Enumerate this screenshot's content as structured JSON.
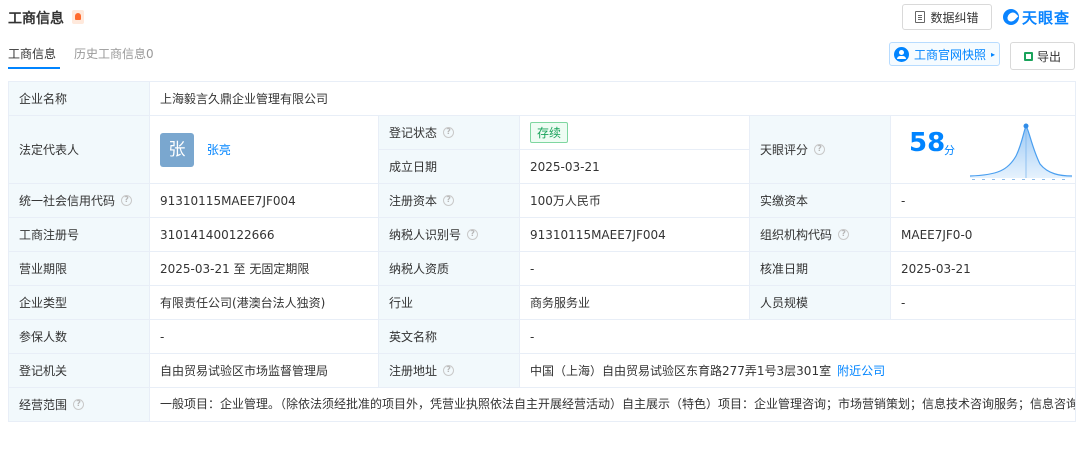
{
  "header": {
    "title": "工商信息",
    "correct_btn": "数据纠错",
    "brand": "天眼查"
  },
  "tabs": [
    {
      "label": "工商信息",
      "active": true
    },
    {
      "label": "历史工商信息0",
      "active": false
    }
  ],
  "actions": {
    "snapshot": "工商官网快照",
    "export": "导出"
  },
  "company": {
    "name_label": "企业名称",
    "name": "上海毅言久鼎企业管理有限公司",
    "legal_rep_label": "法定代表人",
    "legal_rep_avatar": "张",
    "legal_rep_name": "张亮",
    "reg_status_label": "登记状态",
    "reg_status": "存续",
    "est_date_label": "成立日期",
    "est_date": "2025-03-21",
    "score_label": "天眼评分",
    "score": "58",
    "score_unit": "分",
    "credit_code_label": "统一社会信用代码",
    "credit_code": "91310115MAEE7JF004",
    "reg_capital_label": "注册资本",
    "reg_capital": "100万人民币",
    "paid_capital_label": "实缴资本",
    "paid_capital": "-",
    "reg_number_label": "工商注册号",
    "reg_number": "310141400122666",
    "taxpayer_id_label": "纳税人识别号",
    "taxpayer_id": "91310115MAEE7JF004",
    "org_code_label": "组织机构代码",
    "org_code": "MAEE7JF0-0",
    "term_label": "营业期限",
    "term": "2025-03-21 至 无固定期限",
    "taxpayer_qual_label": "纳税人资质",
    "taxpayer_qual": "-",
    "approval_date_label": "核准日期",
    "approval_date": "2025-03-21",
    "type_label": "企业类型",
    "type": "有限责任公司(港澳台法人独资)",
    "industry_label": "行业",
    "industry": "商务服务业",
    "staff_size_label": "人员规模",
    "staff_size": "-",
    "insured_label": "参保人数",
    "insured": "-",
    "english_name_label": "英文名称",
    "english_name": "-",
    "authority_label": "登记机关",
    "authority": "自由贸易试验区市场监督管理局",
    "address_label": "注册地址",
    "address": "中国（上海）自由贸易试验区东育路277弄1号3层301室",
    "nearby_link": "附近公司",
    "scope_label": "经营范围",
    "scope": "一般项目：企业管理。（除依法须经批准的项目外，凭营业执照依法自主开展经营活动）自主展示（特色）项目：企业管理咨询；市场营销策划；信息技术咨询服务；信息咨询服务（不含许可类信息咨询服务）；会议及展览服务；品牌管理；餐饮管理。"
  },
  "colors": {
    "accent": "#0084ff",
    "label_bg": "#f2f9fc",
    "border": "#e8eef7",
    "status_green": "#1aa35b"
  }
}
